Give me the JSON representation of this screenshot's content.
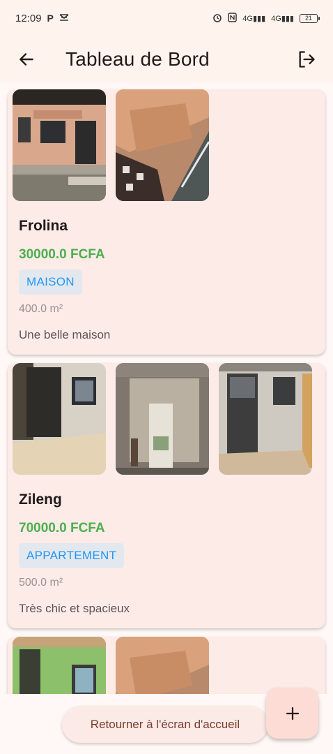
{
  "status_bar": {
    "time": "12:09",
    "left_icons": [
      "P",
      "inbox-icon"
    ],
    "right_icons": [
      "alarm-icon",
      "nfc-icon",
      "signal-4g-icon",
      "signal-4g-icon"
    ],
    "net1": "4G",
    "net2": "4G",
    "battery": "21"
  },
  "app_bar": {
    "title": "Tableau de Bord",
    "back_icon": "arrow-left-icon",
    "logout_icon": "logout-icon"
  },
  "colors": {
    "price": "#4caf50",
    "badge_text": "#2196f3",
    "badge_bg": "#e3e8ef",
    "card_bg": "#fdebe7",
    "fab_bg": "#fcdcd4"
  },
  "listings": [
    {
      "title": "Frolina",
      "price": "30000.0 FCFA",
      "type": "MAISON",
      "area": "400.0 m²",
      "description": "Une belle maison"
    },
    {
      "title": "Zileng",
      "price": "70000.0 FCFA",
      "type": "APPARTEMENT",
      "area": "500.0 m²",
      "description": "Très chic et spacieux"
    }
  ],
  "bottom": {
    "home_button": "Retourner à l'écran d'accueil",
    "fab_icon": "plus-icon"
  }
}
